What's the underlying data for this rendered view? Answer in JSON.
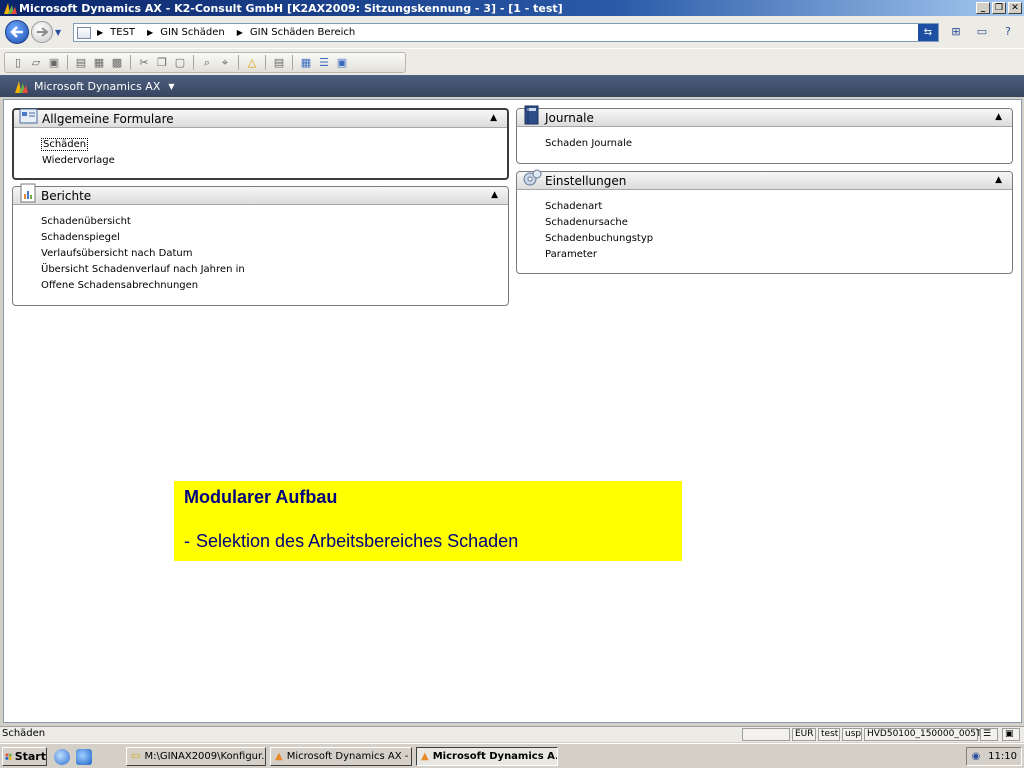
{
  "window": {
    "title": "Microsoft Dynamics AX - K2-Consult GmbH [K2AX2009: Sitzungskennung - 3] - [1 - test]",
    "controls": [
      "_",
      "❐",
      "✕"
    ]
  },
  "address": {
    "breadcrumbs": [
      "TEST",
      "GIN Schäden",
      "GIN Schäden Bereich"
    ]
  },
  "nav_header": {
    "label": "Microsoft Dynamics AX"
  },
  "groups": {
    "allgemeine": {
      "title": "Allgemeine Formulare",
      "items": [
        "Schäden",
        "Wiedervorlage"
      ]
    },
    "berichte": {
      "title": "Berichte",
      "items": [
        "Schadenübersicht",
        "Schadenspiegel",
        "Verlaufsübersicht nach Datum",
        "Übersicht Schadenverlauf nach Jahren in",
        "Offene Schadensabrechnungen"
      ]
    },
    "journale": {
      "title": "Journale",
      "items": [
        "Schaden Journale"
      ]
    },
    "einstellungen": {
      "title": "Einstellungen",
      "items": [
        "Schadenart",
        "Schadenursache",
        "Schadenbuchungstyp",
        "Parameter"
      ]
    }
  },
  "overlay": {
    "title": "Modularer Aufbau",
    "dash": "-",
    "line": "Selektion des Arbeitsbereiches Schaden"
  },
  "statusbar": {
    "text": "Schäden",
    "currency": "EUR",
    "user": "test",
    "company": "usp",
    "server": "HVD50100_150000_005T"
  },
  "taskbar": {
    "start": "Start",
    "tasks": [
      "M:\\GINAX2009\\Konfigur...",
      "Microsoft Dynamics AX - ...",
      "Microsoft Dynamics A..."
    ],
    "clock": "11:10"
  }
}
